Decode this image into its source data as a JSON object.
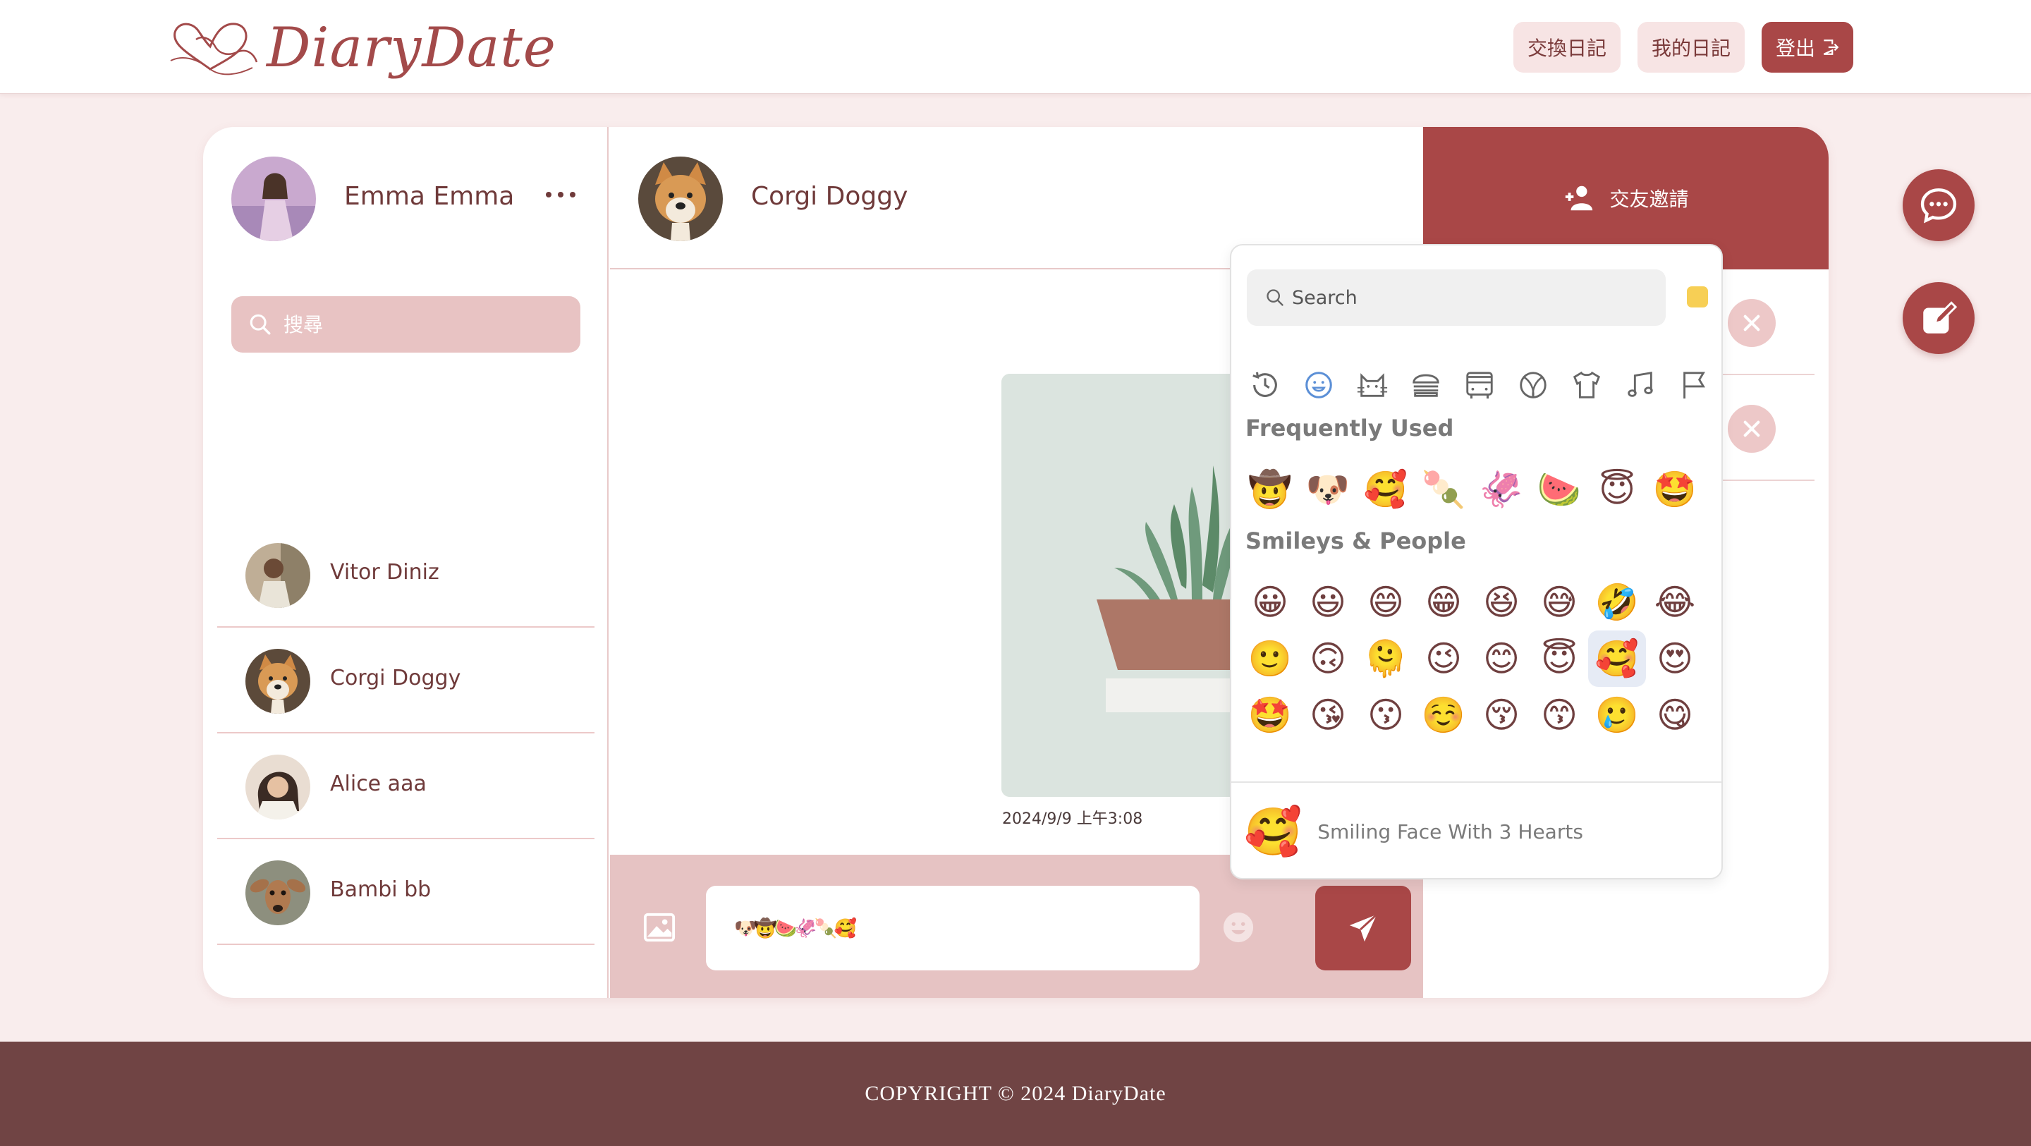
{
  "header": {
    "logo_text": "DiaryDate",
    "nav": {
      "exchange": "交換日記",
      "my_diary": "我的日記",
      "logout": "登出"
    }
  },
  "sidebar": {
    "me_name": "Emma Emma",
    "search_placeholder": "搜尋",
    "friends": [
      {
        "name": "Vitor Diniz"
      },
      {
        "name": "Corgi Doggy"
      },
      {
        "name": "Alice aaa"
      },
      {
        "name": "Bambi bb"
      }
    ]
  },
  "chat": {
    "partner_name": "Corgi Doggy",
    "message_time": "2024/9/9 上午3:08",
    "input_value": "🐶🤠🍉🦑🍡🥰"
  },
  "invites": {
    "title": "交友邀請"
  },
  "emoji_picker": {
    "search_placeholder": "Search",
    "skin_tone_color": "#f7cf55",
    "categories": [
      "clock-icon",
      "smiley-icon",
      "cat-icon",
      "burger-icon",
      "bus-icon",
      "ball-icon",
      "shirt-icon",
      "music-icon",
      "flag-icon"
    ],
    "frequently_used_title": "Frequently Used",
    "frequently_used": [
      "🤠",
      "🐶",
      "🥰",
      "🍡",
      "🦑",
      "🍉",
      "😇",
      "🤩"
    ],
    "smileys_title": "Smileys & People",
    "smileys": [
      "😀",
      "😃",
      "😄",
      "😁",
      "😆",
      "😅",
      "🤣",
      "😂",
      "🙂",
      "🙃",
      "🫠",
      "😉",
      "😊",
      "😇",
      "🥰",
      "😍",
      "🤩",
      "😘",
      "😗",
      "☺️",
      "😚",
      "😙",
      "🥲",
      "😋"
    ],
    "preview_emoji": "🥰",
    "preview_label": "Smiling Face With 3 Hearts"
  },
  "footer": {
    "copyright": "COPYRIGHT © 2024 DiaryDate"
  },
  "colors": {
    "brand": "#a94747",
    "page_bg": "#f9eded",
    "footer_bg": "#704444",
    "composer_bg": "#e6c3c3"
  }
}
